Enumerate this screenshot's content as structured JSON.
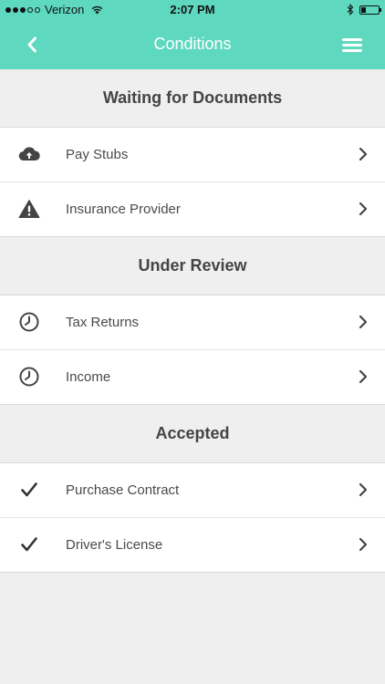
{
  "status_bar": {
    "carrier": "Verizon",
    "time": "2:07 PM",
    "battery_level": 0.25
  },
  "nav": {
    "title": "Conditions"
  },
  "sections": [
    {
      "title": "Waiting for Documents",
      "items": [
        {
          "label": "Pay Stubs",
          "icon": "cloud-upload-icon"
        },
        {
          "label": "Insurance Provider",
          "icon": "warning-icon"
        }
      ]
    },
    {
      "title": "Under Review",
      "items": [
        {
          "label": "Tax Returns",
          "icon": "clock-icon"
        },
        {
          "label": "Income",
          "icon": "clock-icon"
        }
      ]
    },
    {
      "title": "Accepted",
      "items": [
        {
          "label": "Purchase Contract",
          "icon": "checkmark-icon"
        },
        {
          "label": "Driver's License",
          "icon": "checkmark-icon"
        }
      ]
    }
  ],
  "colors": {
    "header": "#5ed8bf",
    "background": "#efefef",
    "text": "#4a4a4a",
    "heading": "#444444"
  }
}
